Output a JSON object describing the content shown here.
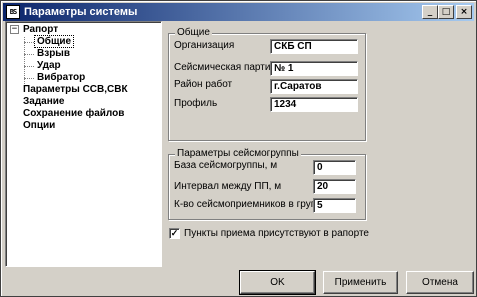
{
  "window": {
    "title": "Параметры системы",
    "icon_label": "BS"
  },
  "titlebar_buttons": {
    "minimize": "_",
    "maximize": "□",
    "close": "×"
  },
  "tree": {
    "root": {
      "expander": "−",
      "label": "Рапорт"
    },
    "children": [
      "Общие",
      "Взрыв",
      "Удар",
      "Вибратор"
    ],
    "items": [
      "Параметры ССВ,СВК",
      "Задание",
      "Сохранение файлов",
      "Опции"
    ]
  },
  "general": {
    "title": "Общие",
    "organization_label": "Организация",
    "organization_value": "СКБ СП",
    "party_label": "Сейсмическая партия",
    "party_value": "№ 1",
    "area_label": "Район работ",
    "area_value": "г.Саратов",
    "profile_label": "Профиль",
    "profile_value": "1234"
  },
  "seismic_group": {
    "title": "Параметры сейсмогруппы",
    "base_label": "База сейсмогруппы, м",
    "base_value": "0",
    "interval_label": "Интервал между ПП, м",
    "interval_value": "20",
    "count_label": "К-во сейсмоприемников в группе",
    "count_value": "5"
  },
  "receiver_points": {
    "label": "Пункты приема присутствуют в рапорте",
    "checked_mark": "✓"
  },
  "buttons": {
    "ok": "OK",
    "apply": "Применить",
    "cancel": "Отмена"
  }
}
